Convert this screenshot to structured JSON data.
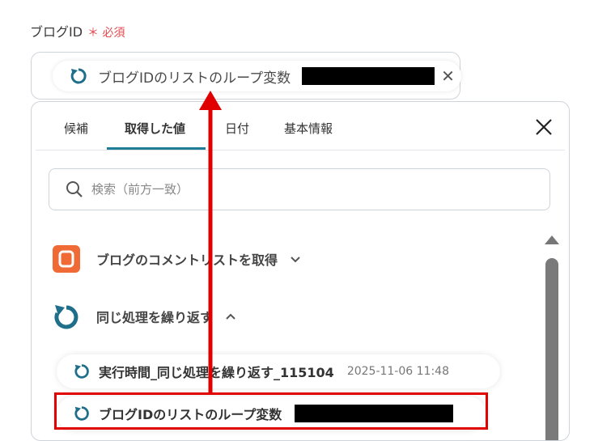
{
  "field": {
    "label": "ブログID",
    "required_mark": "＊",
    "required_text": "必須",
    "chip": {
      "icon": "loop-icon",
      "text": "ブログIDのリストのループ変数",
      "remove_icon": "close-icon",
      "remove_glyph": "✕"
    }
  },
  "dropdown": {
    "tabs": [
      {
        "label": "候補"
      },
      {
        "label": "取得した値"
      },
      {
        "label": "日付"
      },
      {
        "label": "基本情報"
      }
    ],
    "active_tab": "取得した値",
    "close_icon": "close-icon",
    "search": {
      "placeholder": "検索（前方一致）",
      "icon": "search-icon"
    },
    "sections": [
      {
        "title": "ブログのコメントリストを取得",
        "icon": "blogger-icon",
        "expanded": false
      },
      {
        "title": "同じ処理を繰り返す",
        "icon": "loop-icon",
        "expanded": true,
        "items": [
          {
            "label": "実行時間_同じ処理を繰り返す_115104",
            "timestamp": "2025-11-06 11:48"
          },
          {
            "label": "ブログIDのリストのループ変数",
            "timestamp": ""
          }
        ]
      }
    ]
  },
  "colors": {
    "accent": "#1f7e96",
    "required": "#e5484d",
    "annotation": "#e00000",
    "blogger": "#f06a35"
  }
}
